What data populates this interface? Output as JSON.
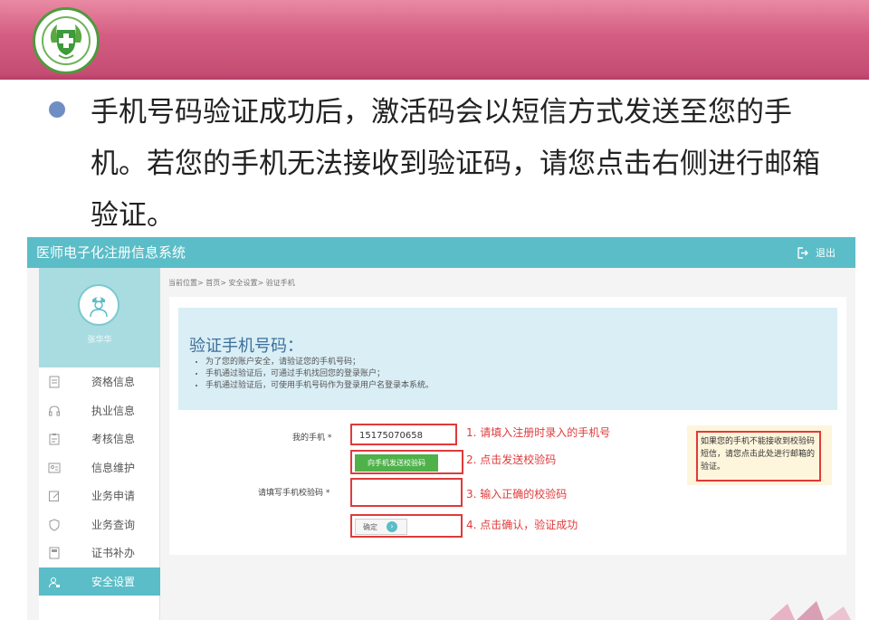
{
  "slide": {
    "text": "手机号码验证成功后，激活码会以短信方式发送至您的手机。若您的手机无法接收到验证码，请您点击右侧进行邮箱验证。",
    "colors": {
      "band": "#d45d82",
      "bullet": "#6f8fc4"
    }
  },
  "app": {
    "title": "医师电子化注册信息系统",
    "logout_label": "退出",
    "username": "张华华",
    "breadcrumb": "当前位置> 首页> 安全设置> 验证手机",
    "menu": [
      {
        "label": "资格信息",
        "icon": "doc-icon"
      },
      {
        "label": "执业信息",
        "icon": "headset-icon"
      },
      {
        "label": "考核信息",
        "icon": "clipboard-icon"
      },
      {
        "label": "信息维护",
        "icon": "id-card-icon"
      },
      {
        "label": "业务申请",
        "icon": "edit-icon"
      },
      {
        "label": "业务查询",
        "icon": "shield-icon"
      },
      {
        "label": "证书补办",
        "icon": "certificate-icon"
      },
      {
        "label": "安全设置",
        "icon": "user-lock-icon",
        "active": true
      }
    ],
    "info": {
      "title": "验证手机号码：",
      "items": [
        "为了您的账户安全，请验证您的手机号码；",
        "手机通过验证后，可通过手机找回您的登录账户；",
        "手机通过验证后，可使用手机号码作为登录用户名登录本系统。"
      ]
    },
    "form": {
      "phone_label": "我的手机 *",
      "phone_value": "15175070658",
      "send_button": "向手机发送校验码",
      "code_label": "请填写手机校验码 *",
      "confirm_label": "确定"
    },
    "steps": [
      "1. 请填入注册时录入的手机号",
      "2. 点击发送校验码",
      "3. 输入正确的校验码",
      "4. 点击确认，验证成功"
    ],
    "email_note": "如果您的手机不能接收到校验码短信，请您点击此处进行邮箱的验证。",
    "colors": {
      "header": "#5bbdc7",
      "highlight": "#e03a3a",
      "send_button": "#4fb14a"
    }
  }
}
